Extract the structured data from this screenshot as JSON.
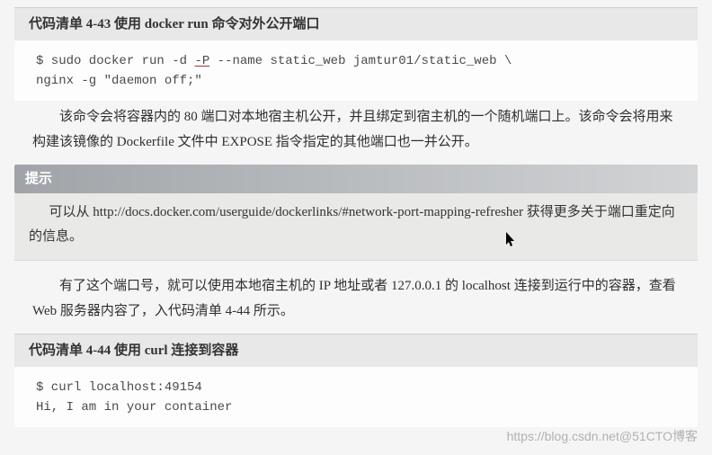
{
  "listing443": {
    "header": "代码清单 4-43   使用 docker run 命令对外公开端口",
    "code_line1_pre": "$ sudo docker run -d ",
    "code_line1_flag": "-P",
    "code_line1_post": " --name static_web jamtur01/static_web \\",
    "code_line2": "nginx -g \"daemon off;\""
  },
  "paragraph1": "该命令会将容器内的 80 端口对本地宿主机公开，并且绑定到宿主机的一个随机端口上。该命令会将用来构建该镜像的 Dockerfile 文件中 EXPOSE 指令指定的其他端口也一并公开。",
  "tip": {
    "label": "提示",
    "text_pre": "可以从 ",
    "url": "http://docs.docker.com/userguide/dockerlinks/#network-port-mapping-refresher",
    "text_post": " 获得更多关于端口重定向的信息。"
  },
  "paragraph2": "有了这个端口号，就可以使用本地宿主机的 IP 地址或者 127.0.0.1 的 localhost 连接到运行中的容器，查看 Web 服务器内容了，入代码清单 4-44 所示。",
  "listing444": {
    "header": "代码清单 4-44   使用 curl 连接到容器",
    "code_line1": "$ curl localhost:49154",
    "code_line2": "Hi, I am in your container"
  },
  "watermark": "https://blog.csdn.net@51CTO博客",
  "cursor_icon": "↖"
}
